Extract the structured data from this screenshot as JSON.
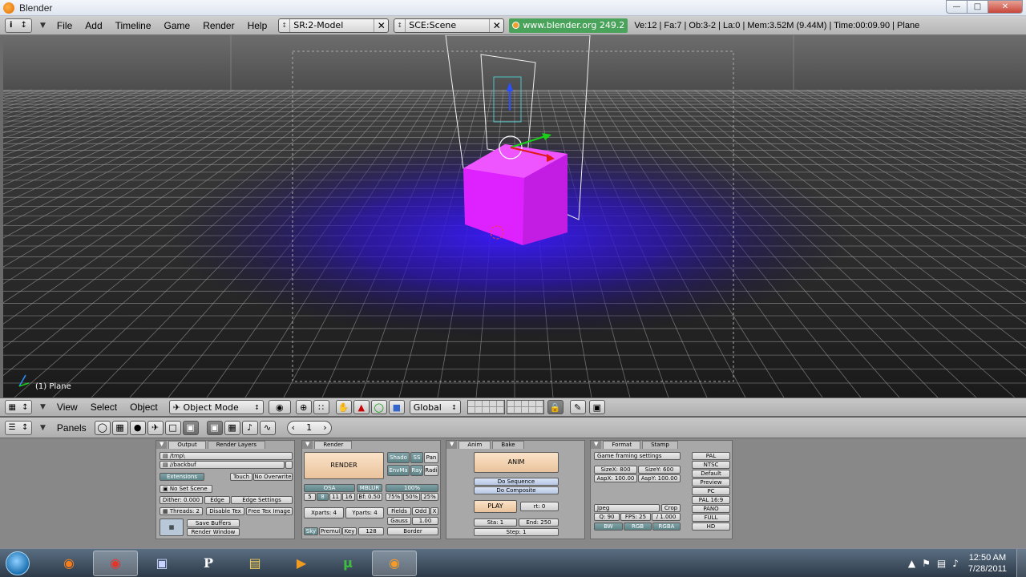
{
  "window": {
    "title": "Blender"
  },
  "menu": {
    "items": [
      "File",
      "Add",
      "Timeline",
      "Game",
      "Render",
      "Help"
    ]
  },
  "screen_field": "SR:2-Model",
  "scene_field": "SCE:Scene",
  "site": "www.blender.org 249.2",
  "stats": "Ve:12 | Fa:7 | Ob:3-2 | La:0  | Mem:3.52M (9.44M)  | Time:00:09.90 | Plane",
  "viewport": {
    "object_label": "(1) Plane"
  },
  "vp_header": {
    "view": "View",
    "select": "Select",
    "object": "Object",
    "mode": "Object Mode",
    "orientation": "Global"
  },
  "buttons": {
    "panels_label": "Panels",
    "frame": "1",
    "output": {
      "tabs": [
        "Output",
        "Render Layers"
      ],
      "path1": "/tmp\\",
      "path2": "//backbuf",
      "extensions": "Extensions",
      "touch": "Touch",
      "no_overwrite": "No Overwrite",
      "no_set_scene": "No Set Scene",
      "dither": "Dither: 0.000",
      "edge": "Edge",
      "edge_settings": "Edge Settings",
      "threads": "Threads: 2",
      "disable_tex": "Disable Tex",
      "free_tex_image": "Free Tex Image",
      "save_buffers": "Save Buffers",
      "render_window": "Render Window"
    },
    "render": {
      "tab": "Render",
      "render_btn": "RENDER",
      "shadow": "Shado",
      "sss": "SS",
      "pan": "Pan",
      "envmap": "EnvMa",
      "ray": "Ray",
      "radio": "Radi",
      "osa": "OSA",
      "mblur": "MBLUR",
      "osa_vals": [
        "5",
        "8",
        "11",
        "16"
      ],
      "bf": "Bf: 0.50",
      "pct100": "100%",
      "pct_vals": [
        "75%",
        "50%",
        "25%"
      ],
      "xparts": "Xparts: 4",
      "yparts": "Yparts: 4",
      "fields": "Fields",
      "odd": "Odd",
      "x": "X",
      "gauss": "Gauss",
      "gauss_val": "1.00",
      "sky": "Sky",
      "premul": "Premul",
      "key": "Key",
      "bits": "128",
      "border": "Border"
    },
    "anim": {
      "tabs": [
        "Anim",
        "Bake"
      ],
      "anim_btn": "ANIM",
      "do_sequence": "Do Sequence",
      "do_composite": "Do Composite",
      "play": "PLAY",
      "rt": "rt: 0",
      "sta": "Sta: 1",
      "end": "End: 250",
      "step": "Step: 1"
    },
    "format": {
      "tabs": [
        "Format",
        "Stamp"
      ],
      "game_framing": "Game framing settings",
      "sizex": "SizeX: 800",
      "sizey": "SizeY: 600",
      "aspx": "AspX: 100.00",
      "aspy": "AspY: 100.00",
      "jpeg": "Jpeg",
      "crop": "Crop",
      "quality": "Q: 90",
      "fps": "FPS: 25",
      "fps_base": "/ 1.000",
      "bw": "BW",
      "rgb": "RGB",
      "rgba": "RGBA",
      "presets": [
        "PAL",
        "NTSC",
        "Default",
        "Preview",
        "PC",
        "PAL 16:9",
        "PANO",
        "FULL",
        "HD"
      ]
    }
  },
  "taskbar": {
    "clock_time": "12:50 AM",
    "clock_date": "7/28/2011"
  },
  "colors": {
    "cube": "#cc22ee",
    "glow": "#3a1aff",
    "grid": "#9a9a9a",
    "panel": "#a8a8a8"
  }
}
